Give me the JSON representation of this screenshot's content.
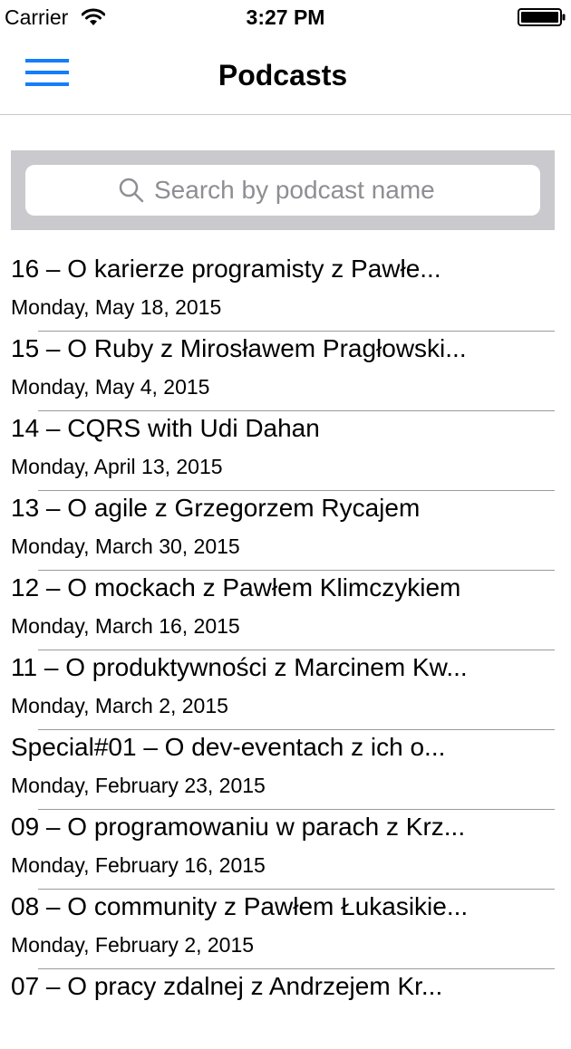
{
  "status_bar": {
    "carrier": "Carrier",
    "time": "3:27 PM"
  },
  "nav": {
    "title": "Podcasts",
    "menu_icon": "hamburger-icon",
    "accent_color": "#147efb"
  },
  "search": {
    "placeholder": "Search by podcast name",
    "value": ""
  },
  "podcasts": [
    {
      "title": "16 – O karierze programisty z Pawłe...",
      "date": "Monday, May 18, 2015"
    },
    {
      "title": "15 – O Ruby z Mirosławem Pragłowski...",
      "date": "Monday, May 4, 2015"
    },
    {
      "title": "14 – CQRS with Udi Dahan",
      "date": "Monday, April 13, 2015"
    },
    {
      "title": "13 – O agile z Grzegorzem Rycajem",
      "date": "Monday, March 30, 2015"
    },
    {
      "title": "12 – O mockach z Pawłem Klimczykiem",
      "date": "Monday, March 16, 2015"
    },
    {
      "title": "11 – O produktywności z Marcinem Kw...",
      "date": "Monday, March 2, 2015"
    },
    {
      "title": "Special#01 – O dev-eventach z ich o...",
      "date": "Monday, February 23, 2015"
    },
    {
      "title": "09 – O programowaniu w parach z Krz...",
      "date": "Monday, February 16, 2015"
    },
    {
      "title": "08 – O community z Pawłem Łukasikie...",
      "date": "Monday, February 2, 2015"
    },
    {
      "title": "07 – O pracy zdalnej z Andrzejem Kr...",
      "date": ""
    }
  ]
}
